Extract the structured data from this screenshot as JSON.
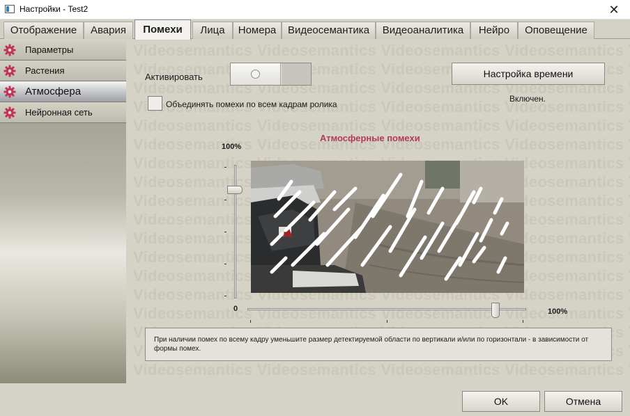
{
  "window": {
    "title": "Настройки - Test2",
    "close_symbol": "✕",
    "app_icon": "window-app-icon"
  },
  "tabs": [
    {
      "label": "Отображение",
      "active": false
    },
    {
      "label": "Авария",
      "active": false
    },
    {
      "label": "Помехи",
      "active": true
    },
    {
      "label": "Лица",
      "active": false
    },
    {
      "label": "Номера",
      "active": false
    },
    {
      "label": "Видеосемантика",
      "active": false
    },
    {
      "label": "Видеоаналитика",
      "active": false
    },
    {
      "label": "Нейро",
      "active": false
    },
    {
      "label": "Оповещение",
      "active": false
    }
  ],
  "sidebar": {
    "icon": "gear-icon",
    "icon_color": "#c0345a",
    "items": [
      {
        "label": "Параметры",
        "active": false
      },
      {
        "label": "Растения",
        "active": false
      },
      {
        "label": "Атмосфера",
        "active": true
      },
      {
        "label": "Нейронная сеть",
        "active": false
      }
    ]
  },
  "content": {
    "watermark": "Videosemantics Videosemantics Videosemantics Videosemantics Videosemantics",
    "activate_label": "Активировать",
    "activate_on": false,
    "time_button": "Настройка времени",
    "status": "Включен.",
    "merge_checkbox_label": "Объединять помехи по всем кадрам ролика",
    "merge_checked": false,
    "image_title": "Атмосферные помехи",
    "vertical_slider": {
      "top_label": "100%",
      "bottom_label": "0",
      "value_percent": 81
    },
    "horizontal_slider": {
      "right_label": "100%",
      "value_percent": 89
    },
    "hint": "При наличии помех по всему кадру уменьшите размер детектируемой области по вертикали и/или по горизонтали - в зависимости от формы помех."
  },
  "footer": {
    "ok_label": "OK",
    "cancel_label": "Отмена"
  },
  "colors": {
    "accent_title": "#b23a5a",
    "panel_bg": "#d5d2c6"
  }
}
